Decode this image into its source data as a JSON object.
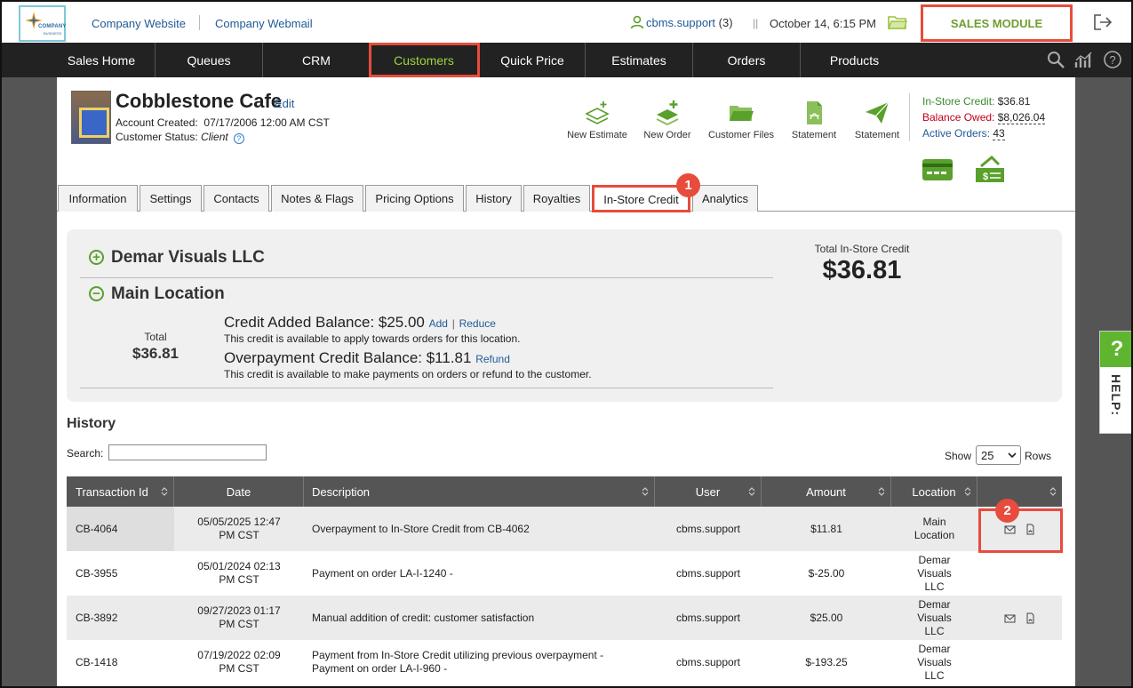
{
  "topbar": {
    "logo_text": "COMPANY",
    "logo_sub": "BUSINESS",
    "link_website": "Company Website",
    "link_webmail": "Company Webmail",
    "user_name": "cbms.support",
    "user_count": "(3)",
    "separator": "||",
    "datetime": "October 14, 6:15 PM",
    "module": "SALES MODULE"
  },
  "nav": {
    "items": [
      "Sales Home",
      "Queues",
      "CRM",
      "Customers",
      "Quick Price",
      "Estimates",
      "Orders",
      "Products"
    ],
    "active": "Customers"
  },
  "customer": {
    "name": "Cobblestone Cafe",
    "edit": "Edit",
    "created_label": "Account Created:",
    "created_value": "07/17/2006 12:00 AM CST",
    "status_label": "Customer Status:",
    "status_value": "Client",
    "help_glyph": "?"
  },
  "actions": [
    "New Estimate",
    "New Order",
    "Customer Files",
    "Statement",
    "Statement"
  ],
  "balances": {
    "instore_label": "In-Store Credit:",
    "instore_value": "$36.81",
    "owed_label": "Balance Owed:",
    "owed_value": "$8,026.04",
    "orders_label": "Active Orders:",
    "orders_value": "43"
  },
  "tabs": [
    "Information",
    "Settings",
    "Contacts",
    "Notes & Flags",
    "Pricing Options",
    "History",
    "Royalties",
    "In-Store Credit",
    "Analytics"
  ],
  "active_tab": "In-Store Credit",
  "badges": [
    "1",
    "2"
  ],
  "credit": {
    "location1": "Demar Visuals LLC",
    "location2": "Main Location",
    "plus": "+",
    "minus": "−",
    "total_label": "Total",
    "total_value": "$36.81",
    "added_text": "Credit Added Balance: $25.00",
    "add_link": "Add",
    "link_sep": "|",
    "reduce_link": "Reduce",
    "added_note": "This credit is available to apply towards orders for this location.",
    "over_text": "Overpayment Credit Balance: $11.81",
    "refund_link": "Refund",
    "over_note": "This credit is available to make payments on orders or refund to the customer.",
    "grand_label": "Total In-Store Credit",
    "grand_value": "$36.81"
  },
  "history": {
    "title": "History",
    "search_label": "Search:",
    "search_value": "",
    "show_label": "Show",
    "rows_value": "25",
    "rows_label": "Rows",
    "columns": [
      "Transaction Id",
      "Date",
      "Description",
      "User",
      "Amount",
      "Location",
      ""
    ],
    "rows": [
      {
        "id": "CB-4064",
        "date": "05/05/2025 12:47 PM CST",
        "desc": "Overpayment to In-Store Credit from CB-4062",
        "user": "cbms.support",
        "amount": "$11.81",
        "location": "Main Location",
        "actions": true
      },
      {
        "id": "CB-3955",
        "date": "05/01/2024 02:13 PM CST",
        "desc": "Payment on order LA-I-1240 -",
        "user": "cbms.support",
        "amount": "$-25.00",
        "location": "Demar Visuals LLC",
        "actions": false
      },
      {
        "id": "CB-3892",
        "date": "09/27/2023 01:17 PM CST",
        "desc": "Manual addition of credit: customer satisfaction",
        "user": "cbms.support",
        "amount": "$25.00",
        "location": "Demar Visuals LLC",
        "actions": true
      },
      {
        "id": "CB-1418",
        "date": "07/19/2022 02:09 PM CST",
        "desc": "Payment from In-Store Credit utilizing previous overpayment - Payment on order LA-I-960 -",
        "user": "cbms.support",
        "amount": "$-193.25",
        "location": "Demar Visuals LLC",
        "actions": false
      }
    ]
  },
  "help": {
    "glyph": "?",
    "label": "HELP:"
  },
  "colors": {
    "accent_green": "#6e9f2f",
    "highlight_red": "#e74c3c",
    "nav_bg": "#222222",
    "link_blue": "#1f5a96"
  }
}
